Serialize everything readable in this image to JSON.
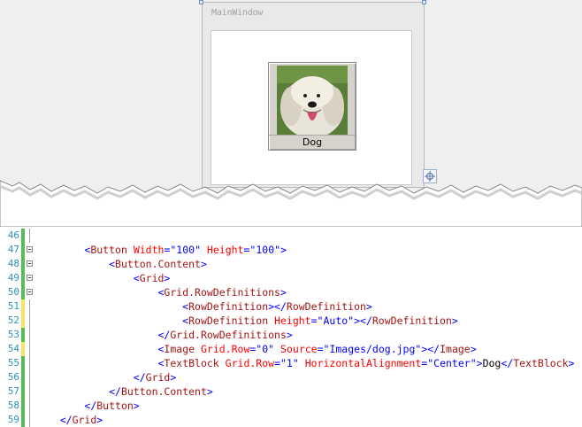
{
  "designer": {
    "window_title": "MainWindow",
    "button_label": "Dog"
  },
  "editor": {
    "lines": [
      {
        "n": "46",
        "indent": "",
        "parts": []
      },
      {
        "n": "47",
        "indent": "    ",
        "parts": [
          [
            "b",
            "<"
          ],
          [
            "e",
            "Button"
          ],
          [
            "t",
            " "
          ],
          [
            "a",
            "Width"
          ],
          [
            "b",
            "=\""
          ],
          [
            "v",
            "100"
          ],
          [
            "b",
            "\""
          ],
          [
            "t",
            " "
          ],
          [
            "a",
            "Height"
          ],
          [
            "b",
            "=\""
          ],
          [
            "v",
            "100"
          ],
          [
            "b",
            "\">"
          ]
        ]
      },
      {
        "n": "48",
        "indent": "        ",
        "parts": [
          [
            "b",
            "<"
          ],
          [
            "e",
            "Button.Content"
          ],
          [
            "b",
            ">"
          ]
        ]
      },
      {
        "n": "49",
        "indent": "            ",
        "parts": [
          [
            "b",
            "<"
          ],
          [
            "e",
            "Grid"
          ],
          [
            "b",
            ">"
          ]
        ]
      },
      {
        "n": "50",
        "indent": "                ",
        "parts": [
          [
            "b",
            "<"
          ],
          [
            "e",
            "Grid.RowDefinitions"
          ],
          [
            "b",
            ">"
          ]
        ]
      },
      {
        "n": "51",
        "indent": "                    ",
        "parts": [
          [
            "b",
            "<"
          ],
          [
            "e",
            "RowDefinition"
          ],
          [
            "b",
            "></"
          ],
          [
            "e",
            "RowDefinition"
          ],
          [
            "b",
            ">"
          ]
        ]
      },
      {
        "n": "52",
        "indent": "                    ",
        "parts": [
          [
            "b",
            "<"
          ],
          [
            "e",
            "RowDefinition"
          ],
          [
            "t",
            " "
          ],
          [
            "a",
            "Height"
          ],
          [
            "b",
            "=\""
          ],
          [
            "v",
            "Auto"
          ],
          [
            "b",
            "\"></"
          ],
          [
            "e",
            "RowDefinition"
          ],
          [
            "b",
            ">"
          ]
        ]
      },
      {
        "n": "53",
        "indent": "                ",
        "parts": [
          [
            "b",
            "</"
          ],
          [
            "e",
            "Grid.RowDefinitions"
          ],
          [
            "b",
            ">"
          ]
        ]
      },
      {
        "n": "54",
        "indent": "                ",
        "parts": [
          [
            "b",
            "<"
          ],
          [
            "e",
            "Image"
          ],
          [
            "t",
            " "
          ],
          [
            "a",
            "Grid.Row"
          ],
          [
            "b",
            "=\""
          ],
          [
            "v",
            "0"
          ],
          [
            "b",
            "\""
          ],
          [
            "t",
            " "
          ],
          [
            "a",
            "Source"
          ],
          [
            "b",
            "=\""
          ],
          [
            "v",
            "Images/dog.jpg"
          ],
          [
            "b",
            "\"></"
          ],
          [
            "e",
            "Image"
          ],
          [
            "b",
            ">"
          ]
        ]
      },
      {
        "n": "55",
        "indent": "                ",
        "parts": [
          [
            "b",
            "<"
          ],
          [
            "e",
            "TextBlock"
          ],
          [
            "t",
            " "
          ],
          [
            "a",
            "Grid.Row"
          ],
          [
            "b",
            "=\""
          ],
          [
            "v",
            "1"
          ],
          [
            "b",
            "\""
          ],
          [
            "t",
            " "
          ],
          [
            "a",
            "HorizontalAlignment"
          ],
          [
            "b",
            "=\""
          ],
          [
            "v",
            "Center"
          ],
          [
            "b",
            "\">"
          ],
          [
            "t",
            "Dog"
          ],
          [
            "b",
            "</"
          ],
          [
            "e",
            "TextBlock"
          ],
          [
            "b",
            ">"
          ]
        ]
      },
      {
        "n": "56",
        "indent": "            ",
        "parts": [
          [
            "b",
            "</"
          ],
          [
            "e",
            "Grid"
          ],
          [
            "b",
            ">"
          ]
        ]
      },
      {
        "n": "57",
        "indent": "        ",
        "parts": [
          [
            "b",
            "</"
          ],
          [
            "e",
            "Button.Content"
          ],
          [
            "b",
            ">"
          ]
        ]
      },
      {
        "n": "58",
        "indent": "    ",
        "parts": [
          [
            "b",
            "</"
          ],
          [
            "e",
            "Button"
          ],
          [
            "b",
            ">"
          ]
        ]
      },
      {
        "n": "59",
        "indent": "",
        "parts": [
          [
            "b",
            "</"
          ],
          [
            "e",
            "Grid"
          ],
          [
            "b",
            ">"
          ]
        ]
      }
    ],
    "change_colors": {
      "saved": "#5cb85c",
      "unsaved": "#f2e36b"
    },
    "change_marks": [
      "saved",
      "saved",
      "saved",
      "saved",
      "saved",
      "unsaved",
      "unsaved",
      "saved",
      "unsaved",
      "saved",
      "saved",
      "saved",
      "saved",
      "saved"
    ],
    "fold_lines": [
      "47",
      "48",
      "49",
      "50"
    ]
  }
}
